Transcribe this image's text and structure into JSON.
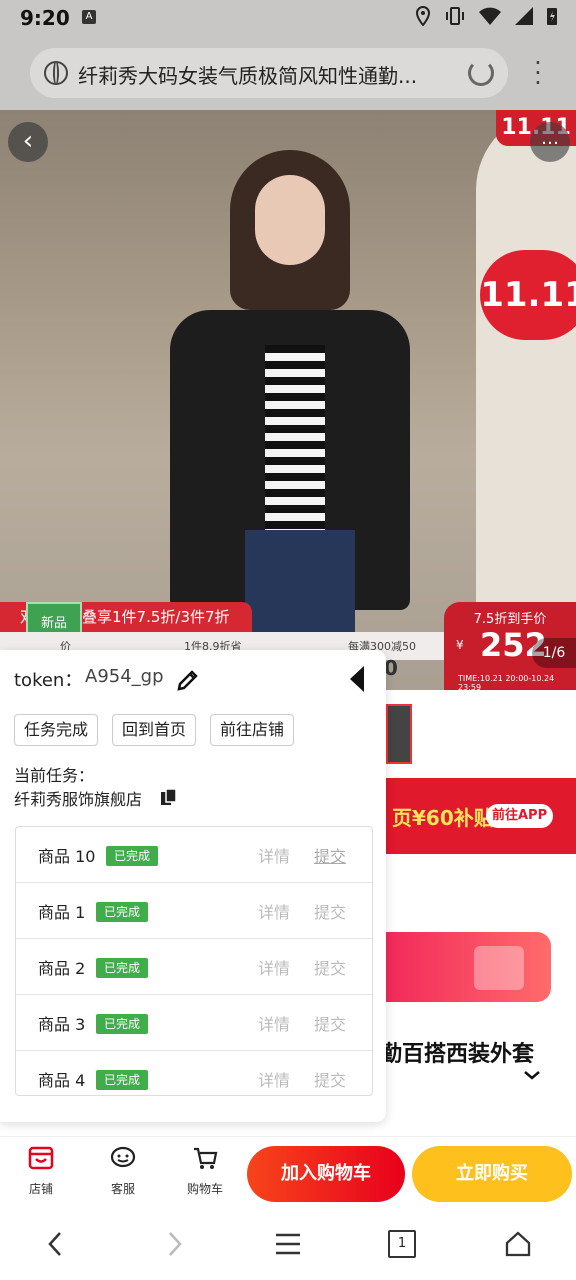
{
  "status_bar": {
    "time": "9:20",
    "a_badge": "A"
  },
  "browser": {
    "page_title": "纤莉秀大码女装气质极简风知性通勤..."
  },
  "hero": {
    "badge_top": "11.11",
    "badge_1111": "11.11",
    "promo_left": "叠享1件7.5折/3件7折",
    "promo_left_prefix": "双",
    "new_tag": "新品",
    "strip_1": "价",
    "strip_2": "1件8.9折省",
    "strip_3": "每满300减50",
    "strip_4": "0",
    "price_title": "7.5折到手价",
    "yen": "¥",
    "price": "252",
    "time": "TIME:10.21 20:00-10.24 23:59",
    "pager": "1/6"
  },
  "background_page": {
    "subsidy_text": "页¥60补贴",
    "subsidy_btn": "前往APP",
    "product_title": "勤百搭西装外套"
  },
  "panel": {
    "token_label": "token：",
    "token_value": "A954_gp",
    "buttons": [
      "任务完成",
      "回到首页",
      "前往店铺"
    ],
    "current_task_label": "当前任务：",
    "current_store": "纤莉秀服饰旗舰店",
    "items": [
      {
        "name": "商品 10",
        "status": "已完成",
        "detail": "详情",
        "submit": "提交"
      },
      {
        "name": "商品 1",
        "status": "已完成",
        "detail": "详情",
        "submit": "提交"
      },
      {
        "name": "商品 2",
        "status": "已完成",
        "detail": "详情",
        "submit": "提交"
      },
      {
        "name": "商品 3",
        "status": "已完成",
        "detail": "详情",
        "submit": "提交"
      },
      {
        "name": "商品 4",
        "status": "已完成",
        "detail": "详情",
        "submit": "提交"
      }
    ]
  },
  "action_bar": {
    "shop": "店铺",
    "service": "客服",
    "cart": "购物车",
    "add_to_cart": "加入购物车",
    "buy_now": "立即购买"
  },
  "system_nav": {
    "tabs_count": "1"
  },
  "colors": {
    "accent_red": "#e8001c",
    "buy_yellow": "#fdc01d",
    "done_green": "#3fae4a"
  }
}
